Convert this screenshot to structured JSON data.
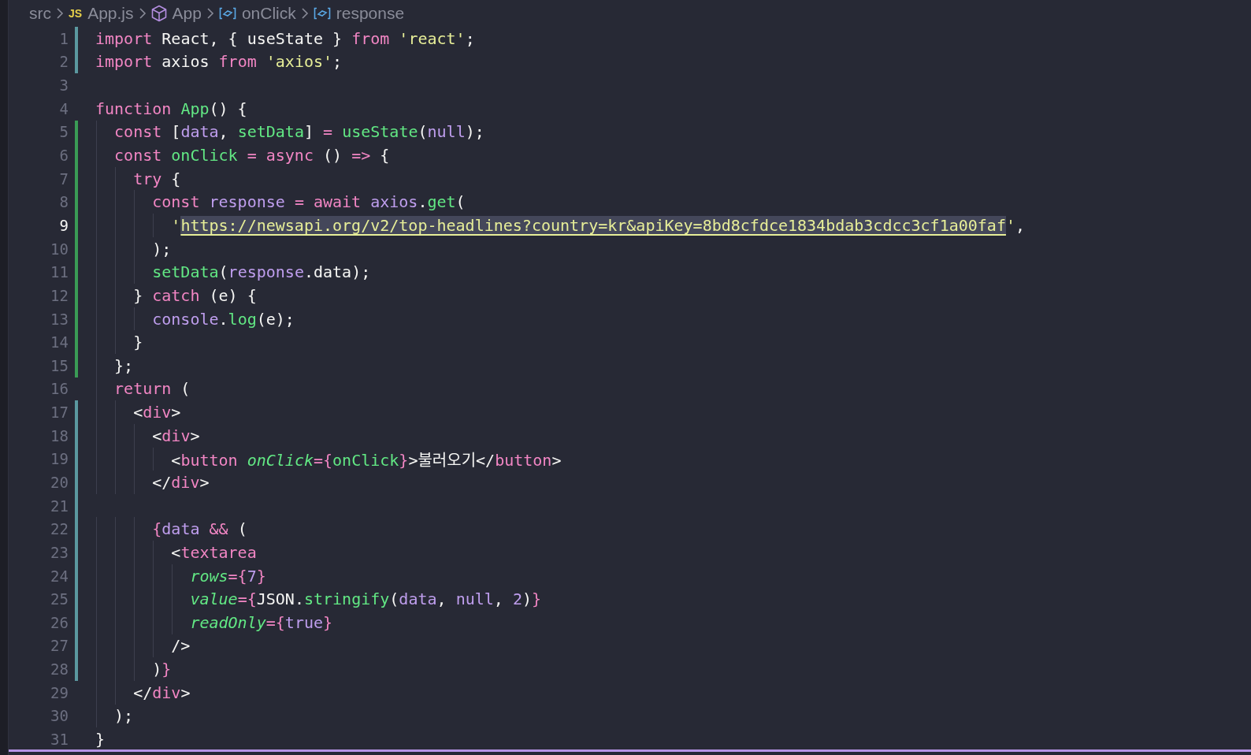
{
  "breadcrumb": [
    {
      "kind": "folder",
      "label": "src"
    },
    {
      "kind": "file",
      "icon_text": "JS",
      "label": "App.js"
    },
    {
      "kind": "component",
      "label": "App"
    },
    {
      "kind": "variable",
      "label": "onClick"
    },
    {
      "kind": "variable",
      "label": "response"
    }
  ],
  "editor": {
    "lines": [
      {
        "number": "1",
        "modified": true,
        "added": false,
        "current": false,
        "tokens": [
          {
            "kind": "keyword",
            "text": "import "
          },
          {
            "kind": "plain",
            "text": "React, { useState } "
          },
          {
            "kind": "keyword",
            "text": "from "
          },
          {
            "kind": "string",
            "text": "'react'"
          },
          {
            "kind": "plain",
            "text": ";"
          }
        ]
      },
      {
        "number": "2",
        "modified": true,
        "added": false,
        "current": false,
        "tokens": [
          {
            "kind": "keyword",
            "text": "import "
          },
          {
            "kind": "plain",
            "text": "axios "
          },
          {
            "kind": "keyword",
            "text": "from "
          },
          {
            "kind": "string",
            "text": "'axios'"
          },
          {
            "kind": "plain",
            "text": ";"
          }
        ]
      },
      {
        "number": "3",
        "modified": false,
        "added": false,
        "current": false
      },
      {
        "number": "4",
        "modified": false,
        "added": false,
        "current": false,
        "tokens": [
          {
            "kind": "keyword",
            "text": "function "
          },
          {
            "kind": "function",
            "text": "App"
          },
          {
            "kind": "plain",
            "text": "() {"
          }
        ]
      },
      {
        "number": "5",
        "modified": false,
        "added": true,
        "current": false,
        "tokens": [
          {
            "kind": "keyword",
            "text": "  const"
          },
          {
            "kind": "plain",
            "text": " ["
          },
          {
            "kind": "variable",
            "text": "data"
          },
          {
            "kind": "plain",
            "text": ", "
          },
          {
            "kind": "function",
            "text": "setData"
          },
          {
            "kind": "plain",
            "text": "] "
          },
          {
            "kind": "keyword",
            "text": "= "
          },
          {
            "kind": "function",
            "text": "useState"
          },
          {
            "kind": "plain",
            "text": "("
          },
          {
            "kind": "variable",
            "text": "null"
          },
          {
            "kind": "plain",
            "text": ");"
          }
        ]
      },
      {
        "number": "6",
        "modified": false,
        "added": true,
        "current": false,
        "tokens": [
          {
            "kind": "keyword",
            "text": "  const "
          },
          {
            "kind": "function",
            "text": "onClick "
          },
          {
            "kind": "keyword",
            "text": "= async"
          },
          {
            "kind": "plain",
            "text": " () "
          },
          {
            "kind": "keyword",
            "text": "=>"
          },
          {
            "kind": "plain",
            "text": " {"
          }
        ]
      },
      {
        "number": "7",
        "modified": false,
        "added": true,
        "current": false,
        "tokens": [
          {
            "kind": "keyword",
            "text": "    try"
          },
          {
            "kind": "plain",
            "text": " {"
          }
        ]
      },
      {
        "number": "8",
        "modified": false,
        "added": true,
        "current": false,
        "tokens": [
          {
            "kind": "keyword",
            "text": "      const "
          },
          {
            "kind": "variable",
            "text": "response "
          },
          {
            "kind": "keyword",
            "text": "= await "
          },
          {
            "kind": "variable",
            "text": "axios"
          },
          {
            "kind": "plain",
            "text": "."
          },
          {
            "kind": "function",
            "text": "get"
          },
          {
            "kind": "plain",
            "text": "("
          }
        ]
      },
      {
        "number": "9",
        "modified": false,
        "added": true,
        "current": true,
        "tokens": [
          {
            "kind": "string",
            "text": "        '"
          },
          {
            "kind": "link",
            "text": "https://newsapi.org/v2/top-headlines?country=kr&apiKey=8bd8cfdce1834bdab3cdcc3cf1a00faf"
          },
          {
            "kind": "string",
            "text": "'"
          },
          {
            "kind": "plain",
            "text": ","
          }
        ]
      },
      {
        "number": "10",
        "modified": false,
        "added": true,
        "current": false,
        "tokens": [
          {
            "kind": "plain",
            "text": "      );"
          }
        ]
      },
      {
        "number": "11",
        "modified": false,
        "added": true,
        "current": false,
        "tokens": [
          {
            "kind": "function",
            "text": "      setData"
          },
          {
            "kind": "plain",
            "text": "("
          },
          {
            "kind": "variable",
            "text": "response"
          },
          {
            "kind": "plain",
            "text": ".data);"
          }
        ]
      },
      {
        "number": "12",
        "modified": false,
        "added": true,
        "current": false,
        "tokens": [
          {
            "kind": "plain",
            "text": "    } "
          },
          {
            "kind": "keyword",
            "text": "catch"
          },
          {
            "kind": "plain",
            "text": " (e) {"
          }
        ]
      },
      {
        "number": "13",
        "modified": false,
        "added": true,
        "current": false,
        "tokens": [
          {
            "kind": "variable",
            "text": "      console"
          },
          {
            "kind": "plain",
            "text": "."
          },
          {
            "kind": "function",
            "text": "log"
          },
          {
            "kind": "plain",
            "text": "(e);"
          }
        ]
      },
      {
        "number": "14",
        "modified": false,
        "added": true,
        "current": false,
        "tokens": [
          {
            "kind": "plain",
            "text": "    }"
          }
        ]
      },
      {
        "number": "15",
        "modified": false,
        "added": true,
        "current": false,
        "tokens": [
          {
            "kind": "plain",
            "text": "  };"
          }
        ]
      },
      {
        "number": "16",
        "modified": false,
        "added": false,
        "current": false,
        "tokens": [
          {
            "kind": "keyword",
            "text": "  return"
          },
          {
            "kind": "plain",
            "text": " ("
          }
        ]
      },
      {
        "number": "17",
        "modified": true,
        "added": false,
        "current": false,
        "tokens": [
          {
            "kind": "plain",
            "text": "    <"
          },
          {
            "kind": "keyword",
            "text": "div"
          },
          {
            "kind": "plain",
            "text": ">"
          }
        ]
      },
      {
        "number": "18",
        "modified": true,
        "added": false,
        "current": false,
        "tokens": [
          {
            "kind": "plain",
            "text": "      <"
          },
          {
            "kind": "keyword",
            "text": "div"
          },
          {
            "kind": "plain",
            "text": ">"
          }
        ]
      },
      {
        "number": "19",
        "modified": true,
        "added": false,
        "current": false,
        "tokens": [
          {
            "kind": "plain",
            "text": "        <"
          },
          {
            "kind": "keyword",
            "text": "button "
          },
          {
            "kind": "attribute",
            "text": "onClick"
          },
          {
            "kind": "keyword",
            "text": "={"
          },
          {
            "kind": "function",
            "text": "onClick"
          },
          {
            "kind": "keyword",
            "text": "}"
          },
          {
            "kind": "plain",
            "text": ">불러오기</"
          },
          {
            "kind": "keyword",
            "text": "button"
          },
          {
            "kind": "plain",
            "text": ">"
          }
        ]
      },
      {
        "number": "20",
        "modified": true,
        "added": false,
        "current": false,
        "tokens": [
          {
            "kind": "plain",
            "text": "      </"
          },
          {
            "kind": "keyword",
            "text": "div"
          },
          {
            "kind": "plain",
            "text": ">"
          }
        ]
      },
      {
        "number": "21",
        "modified": true,
        "added": false,
        "current": false
      },
      {
        "number": "22",
        "modified": true,
        "added": false,
        "current": false,
        "tokens": [
          {
            "kind": "keyword",
            "text": "      {"
          },
          {
            "kind": "variable",
            "text": "data "
          },
          {
            "kind": "keyword",
            "text": "&&"
          },
          {
            "kind": "plain",
            "text": " ("
          }
        ]
      },
      {
        "number": "23",
        "modified": true,
        "added": false,
        "current": false,
        "tokens": [
          {
            "kind": "plain",
            "text": "        <"
          },
          {
            "kind": "keyword",
            "text": "textarea"
          }
        ]
      },
      {
        "number": "24",
        "modified": true,
        "added": false,
        "current": false,
        "tokens": [
          {
            "kind": "attribute",
            "text": "          rows"
          },
          {
            "kind": "keyword",
            "text": "={"
          },
          {
            "kind": "variable",
            "text": "7"
          },
          {
            "kind": "keyword",
            "text": "}"
          }
        ]
      },
      {
        "number": "25",
        "modified": true,
        "added": false,
        "current": false,
        "tokens": [
          {
            "kind": "attribute",
            "text": "          value"
          },
          {
            "kind": "keyword",
            "text": "={"
          },
          {
            "kind": "plain",
            "text": "JSON."
          },
          {
            "kind": "function",
            "text": "stringify"
          },
          {
            "kind": "plain",
            "text": "("
          },
          {
            "kind": "variable",
            "text": "data"
          },
          {
            "kind": "plain",
            "text": ", "
          },
          {
            "kind": "variable",
            "text": "null"
          },
          {
            "kind": "plain",
            "text": ", "
          },
          {
            "kind": "variable",
            "text": "2"
          },
          {
            "kind": "plain",
            "text": ")"
          },
          {
            "kind": "keyword",
            "text": "}"
          }
        ]
      },
      {
        "number": "26",
        "modified": true,
        "added": false,
        "current": false,
        "tokens": [
          {
            "kind": "attribute",
            "text": "          readOnly"
          },
          {
            "kind": "keyword",
            "text": "={"
          },
          {
            "kind": "variable",
            "text": "true"
          },
          {
            "kind": "keyword",
            "text": "}"
          }
        ]
      },
      {
        "number": "27",
        "modified": true,
        "added": false,
        "current": false,
        "tokens": [
          {
            "kind": "plain",
            "text": "        />"
          }
        ]
      },
      {
        "number": "28",
        "modified": true,
        "added": false,
        "current": false,
        "tokens": [
          {
            "kind": "plain",
            "text": "      )"
          },
          {
            "kind": "keyword",
            "text": "}"
          }
        ]
      },
      {
        "number": "29",
        "modified": false,
        "added": false,
        "current": false,
        "tokens": [
          {
            "kind": "plain",
            "text": "    </"
          },
          {
            "kind": "keyword",
            "text": "div"
          },
          {
            "kind": "plain",
            "text": ">"
          }
        ]
      },
      {
        "number": "30",
        "modified": false,
        "added": false,
        "current": false,
        "tokens": [
          {
            "kind": "plain",
            "text": "  );"
          }
        ]
      },
      {
        "number": "31",
        "modified": false,
        "added": false,
        "current": false,
        "tokens": [
          {
            "kind": "plain",
            "text": "}"
          }
        ]
      }
    ]
  }
}
